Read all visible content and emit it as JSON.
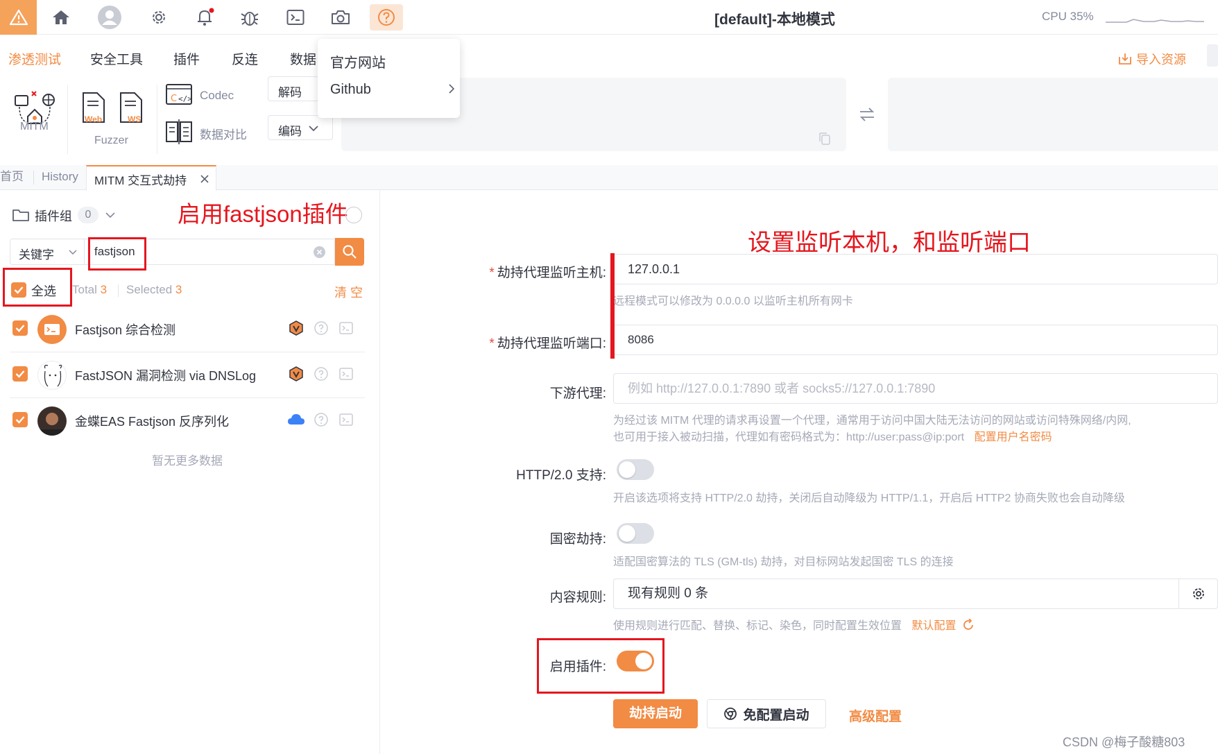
{
  "topbar": {
    "title": "[default]-本地模式",
    "cpu": "CPU 35%",
    "icons": [
      "warning-icon",
      "home-icon",
      "user-avatar-icon",
      "gear-icon",
      "bell-icon",
      "bug-icon",
      "terminal-icon",
      "camera-icon",
      "help-icon"
    ]
  },
  "help_menu": {
    "items": [
      "官方网站",
      "Github"
    ]
  },
  "menu": {
    "items": [
      "渗透测试",
      "安全工具",
      "插件",
      "反连",
      "数据"
    ],
    "import_label": "导入资源"
  },
  "toolbar": {
    "mitm_label": "MITM",
    "fuzzer_label": "Fuzzer",
    "codec_label": "Codec",
    "compare_label": "数据对比",
    "web_badge": "Web",
    "ws_badge": "WS",
    "decode_label": "解码",
    "encode_label": "编码"
  },
  "tabs": [
    "首页",
    "History",
    "MITM 交互式劫持"
  ],
  "left": {
    "group_label": "插件组",
    "group_count": "0",
    "annotation": "启用fastjson插件",
    "search_type": "关键字",
    "search_value": "fastjson",
    "select_all": "全选",
    "total_label": "Total",
    "total_value": "3",
    "selected_label": "Selected",
    "selected_value": "3",
    "clear": "清 空",
    "plugins": [
      {
        "name": "Fastjson 综合检测"
      },
      {
        "name": "FastJSON 漏洞检测 via DNSLog"
      },
      {
        "name": "金蝶EAS Fastjson 反序列化"
      }
    ],
    "no_more": "暂无更多数据"
  },
  "form": {
    "annotation": "设置监听本机，和监听端口",
    "host_label": "劫持代理监听主机:",
    "host_value": "127.0.0.1",
    "host_help": "远程模式可以修改为 0.0.0.0 以监听主机所有网卡",
    "port_label": "劫持代理监听端口:",
    "port_value": "8086",
    "downstream_label": "下游代理:",
    "downstream_placeholder": "例如 http://127.0.0.1:7890 或者 socks5://127.0.0.1:7890",
    "downstream_help1": "为经过该 MITM 代理的请求再设置一个代理，通常用于访问中国大陆无法访问的网站或访问特殊网络/内网,",
    "downstream_help2": "也可用于接入被动扫描，代理如有密码格式为：http://user:pass@ip:port",
    "downstream_link": "配置用户名密码",
    "http2_label": "HTTP/2.0 支持:",
    "http2_on": false,
    "http2_help": "开启该选项将支持 HTTP/2.0 劫持，关闭后自动降级为 HTTP/1.1，开启后 HTTP2 协商失败也会自动降级",
    "gm_label": "国密劫持:",
    "gm_on": false,
    "gm_help": "适配国密算法的 TLS (GM-tls) 劫持，对目标网站发起国密 TLS 的连接",
    "rules_label": "内容规则:",
    "rules_value": "现有规则 0 条",
    "rules_help": "使用规则进行匹配、替换、标记、染色，同时配置生效位置",
    "rules_link": "默认配置",
    "plugin_label": "启用插件:",
    "plugin_on": true,
    "start_button": "劫持启动",
    "noconfig_button": "免配置启动",
    "advanced_button": "高级配置"
  },
  "watermark": "CSDN @梅子酸糖803",
  "colors": {
    "accent": "#f28b44",
    "annotation_red": "#e5161e",
    "muted": "#85899e"
  }
}
